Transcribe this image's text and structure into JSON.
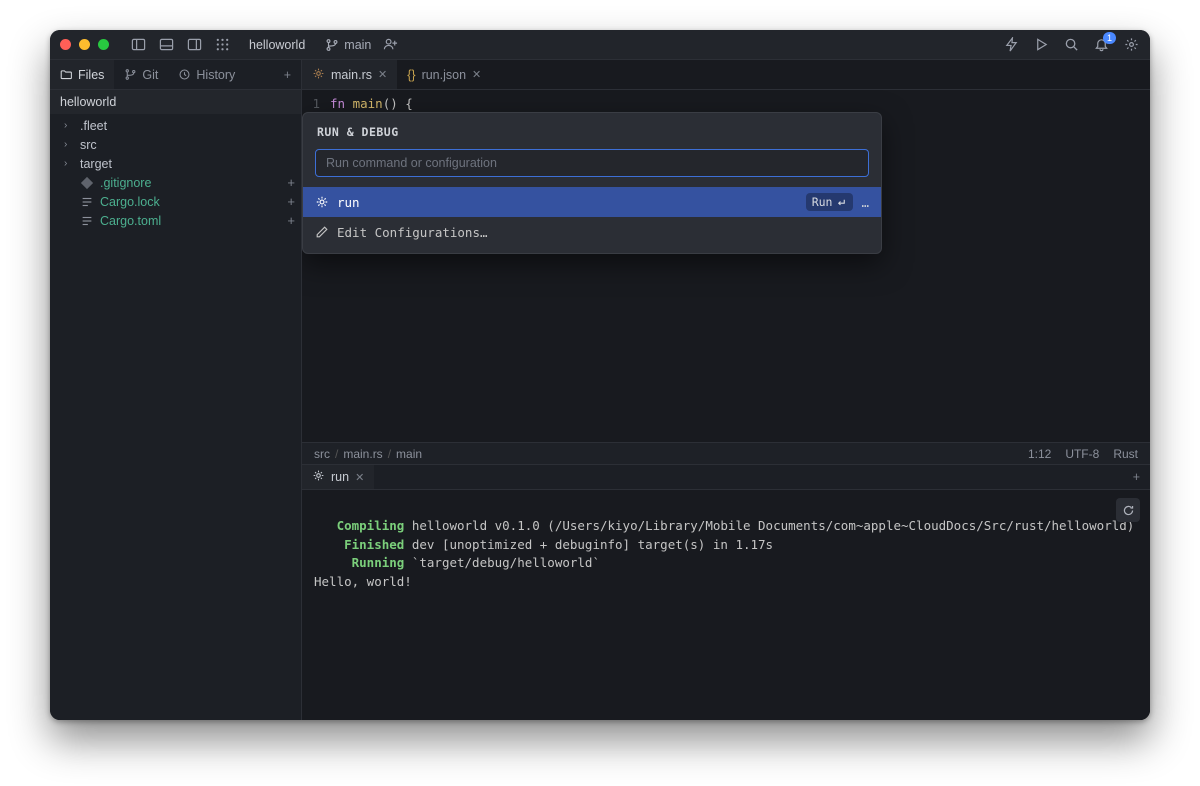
{
  "titlebar": {
    "project": "helloworld",
    "branch": "main",
    "notification_count": "1"
  },
  "sidebar": {
    "tabs": {
      "files": "Files",
      "git": "Git",
      "history": "History"
    },
    "project_header": "helloworld",
    "tree": {
      "fleet": ".fleet",
      "src": "src",
      "target": "target",
      "gitignore": ".gitignore",
      "cargo_lock": "Cargo.lock",
      "cargo_toml": "Cargo.toml"
    }
  },
  "editor": {
    "tabs": {
      "main_rs": "main.rs",
      "run_json": "run.json"
    },
    "code": {
      "line_no": "1",
      "kw": "fn",
      "fn_name": "main",
      "parens": "()",
      "brace": "{"
    }
  },
  "run_debug": {
    "title": "RUN & DEBUG",
    "placeholder": "Run command or configuration",
    "selected": {
      "label": "run",
      "pill": "Run",
      "more": "…"
    },
    "edit": "Edit Configurations…"
  },
  "status": {
    "bc_src": "src",
    "bc_file": "main.rs",
    "bc_fn": "main",
    "pos": "1:12",
    "enc": "UTF-8",
    "lang": "Rust"
  },
  "run_panel": {
    "tab": "run"
  },
  "terminal": {
    "line1a": "   Compiling",
    "line1b": " helloworld v0.1.0 (/Users/kiyo/Library/Mobile Documents/com~apple~CloudDocs/Src/rust/helloworld)",
    "line2a": "    Finished",
    "line2b": " dev [unoptimized + debuginfo] target(s) in 1.17s",
    "line3a": "     Running",
    "line3b": " `target/debug/helloworld`",
    "line4": "Hello, world!"
  }
}
